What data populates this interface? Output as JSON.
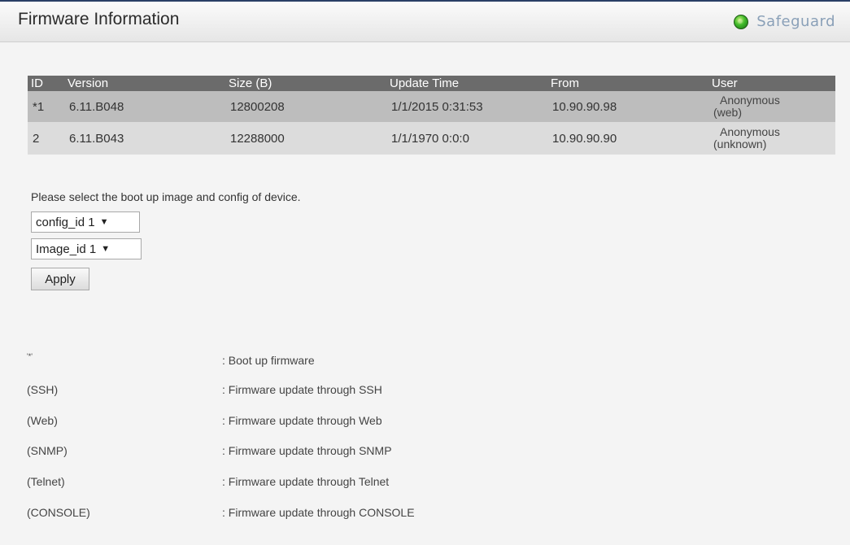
{
  "header": {
    "title": "Firmware Information",
    "safeguard_label": "Safeguard",
    "safeguard_color": "#3fb92a"
  },
  "table": {
    "columns": [
      "ID",
      "Version",
      "Size (B)",
      "Update Time",
      "From",
      "User"
    ],
    "rows": [
      {
        "id": "*1",
        "version": "6.11.B048",
        "size": "12800208",
        "update_time": "1/1/2015 0:31:53",
        "from": "10.90.90.98",
        "user_line1": "Anonymous",
        "user_line2": "(web)"
      },
      {
        "id": "2",
        "version": "6.11.B043",
        "size": "12288000",
        "update_time": "1/1/1970 0:0:0",
        "from": "10.90.90.90",
        "user_line1": "Anonymous",
        "user_line2": "(unknown)"
      }
    ]
  },
  "boot": {
    "prompt": "Please select the boot up image and config of device.",
    "config_value": "config_id 1",
    "image_value": "Image_id 1",
    "apply_label": "Apply"
  },
  "legend": [
    {
      "key": "'*'",
      "desc": ": Boot up firmware"
    },
    {
      "key": "(SSH)",
      "desc": ": Firmware update through SSH"
    },
    {
      "key": "(Web)",
      "desc": ": Firmware update through Web"
    },
    {
      "key": "(SNMP)",
      "desc": ": Firmware update through SNMP"
    },
    {
      "key": "(Telnet)",
      "desc": ": Firmware update through Telnet"
    },
    {
      "key": "(CONSOLE)",
      "desc": ": Firmware update through CONSOLE"
    }
  ]
}
